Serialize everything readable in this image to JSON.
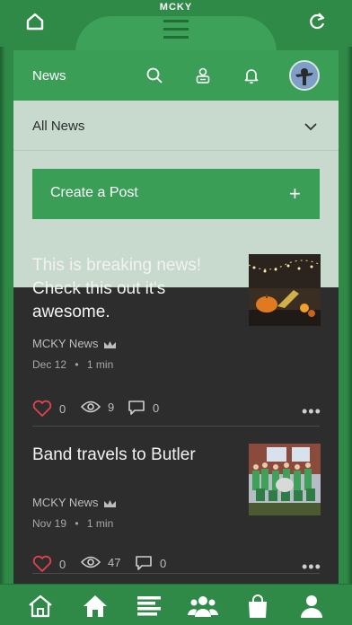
{
  "app": {
    "title": "MCKY"
  },
  "header": {
    "title": "News"
  },
  "filter": {
    "selected": "All News"
  },
  "create_post": {
    "label": "Create a Post",
    "plus": "+"
  },
  "posts": [
    {
      "title": "This is breaking news! Check this out it's awesome.",
      "author": "MCKY News",
      "date": "Dec 12",
      "read_time": "1 min",
      "likes": "0",
      "views": "9",
      "comments": "0"
    },
    {
      "title": "Band travels to Butler",
      "author": "MCKY News",
      "date": "Nov 19",
      "read_time": "1 min",
      "likes": "0",
      "views": "47",
      "comments": "0"
    }
  ],
  "meta_separator": "•",
  "more_label": "•••",
  "colors": {
    "brand_green": "#3b9e57",
    "dark_bg": "#2d2d2d",
    "filter_bg": "#c8d9ce",
    "like_red": "#e0424f"
  },
  "icons": {
    "top_left": "home-outline-icon",
    "top_right": "refresh-icon",
    "header": [
      "search-icon",
      "contacts-icon",
      "bell-icon"
    ],
    "bottom_nav": [
      "home-outline-icon",
      "home-filled-icon",
      "list-icon",
      "group-icon",
      "shopping-bag-icon",
      "person-icon"
    ]
  }
}
